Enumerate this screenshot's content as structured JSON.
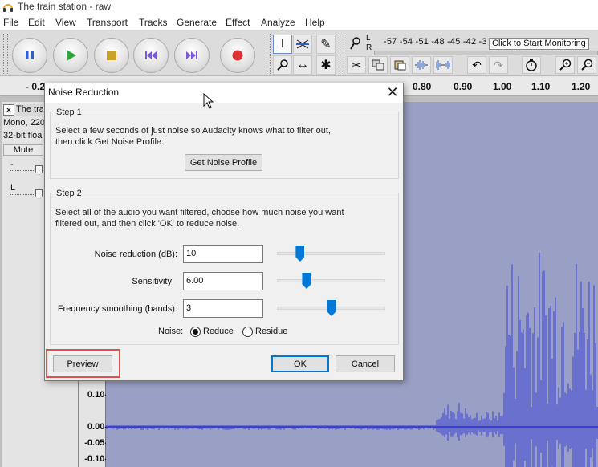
{
  "window": {
    "title": "The train station - raw"
  },
  "menu": [
    "File",
    "Edit",
    "View",
    "Transport",
    "Tracks",
    "Generate",
    "Effect",
    "Analyze",
    "Help"
  ],
  "meter": {
    "labels": "-57 -54 -51 -48 -45 -42 -3",
    "lr_top": "L",
    "lr_bottom": "R",
    "monitor_tip": "Click to Start Monitoring",
    "small_labels": [
      "L",
      "R"
    ]
  },
  "timeline": {
    "ticks": [
      "- 0.20",
      "0.80",
      "0.90",
      "1.00",
      "1.10",
      "1.20"
    ]
  },
  "track": {
    "name": "The tra",
    "info1": "Mono, 220",
    "info2": "32-bit floa",
    "mute_label": "Mute",
    "gain_label": "-",
    "pan_label": "L",
    "amplitude": [
      "0.10-",
      "0.00-",
      "-0.05-",
      "-0.10-"
    ]
  },
  "dialog": {
    "title": "Noise Reduction",
    "step1": {
      "title": "Step 1",
      "text_line1": "Select a few seconds of just noise so Audacity knows what to filter out,",
      "text_line2": "then click Get Noise Profile:",
      "button": "Get Noise Profile"
    },
    "step2": {
      "title": "Step 2",
      "text_line1": "Select all of the audio you want filtered, choose how much noise you want",
      "text_line2": "filtered out, and then click 'OK' to reduce noise.",
      "noise_reduction_label": "Noise reduction (dB):",
      "noise_reduction_value": "10",
      "noise_reduction_level": 0.21,
      "sensitivity_label": "Sensitivity:",
      "sensitivity_value": "6.00",
      "sensitivity_level": 0.27,
      "smoothing_label": "Frequency smoothing (bands):",
      "smoothing_value": "3",
      "smoothing_level": 0.5,
      "noise_label": "Noise:",
      "reduce_label": "Reduce",
      "residue_label": "Residue",
      "selected": "Reduce"
    },
    "buttons": {
      "preview": "Preview",
      "ok": "OK",
      "cancel": "Cancel"
    }
  },
  "colors": {
    "accent": "#0078d7",
    "highlight": "#d9534f",
    "waveform": "#3b3fd6"
  }
}
